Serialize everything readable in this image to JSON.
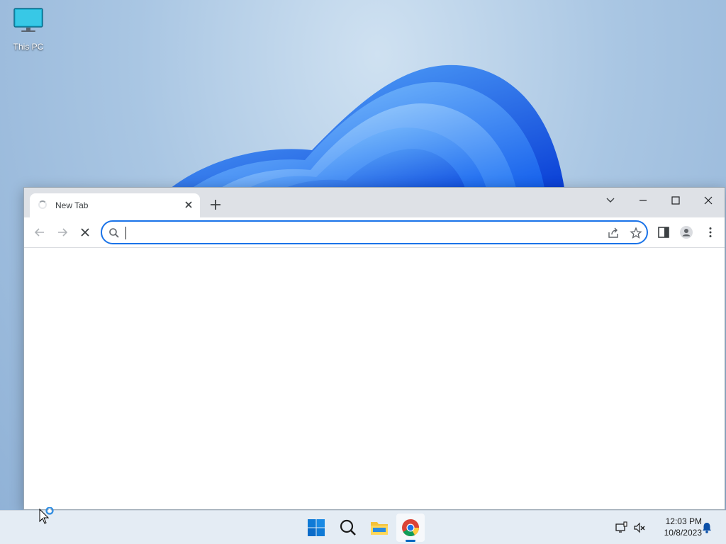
{
  "desktop": {
    "icons": [
      {
        "label": "This PC",
        "icon": "monitor-icon"
      }
    ]
  },
  "browser": {
    "tabs": [
      {
        "title": "New Tab",
        "state": "loading",
        "active": true
      }
    ],
    "window_controls": [
      "tab-search-icon",
      "minimize-icon",
      "maximize-icon",
      "close-icon"
    ],
    "toolbar": {
      "back_icon": "arrow-left-icon",
      "forward_icon": "arrow-right-icon",
      "stop_icon": "stop-x-icon",
      "right_icons": [
        "side-panel-icon",
        "profile-icon",
        "kebab-menu-icon"
      ]
    },
    "omnibox": {
      "value": "",
      "placeholder": "",
      "left_icon": "search-icon",
      "right_icons": [
        "share-icon",
        "star-icon"
      ]
    }
  },
  "taskbar": {
    "apps": [
      {
        "name": "start",
        "icon": "windows-logo-icon"
      },
      {
        "name": "search",
        "icon": "search-icon"
      },
      {
        "name": "file-explorer",
        "icon": "folder-icon"
      },
      {
        "name": "chrome",
        "icon": "chrome-icon",
        "active": true
      }
    ],
    "tray_icons": [
      "network-icon",
      "volume-muted-icon",
      "notification-bell-icon"
    ],
    "clock": {
      "time": "12:03 PM",
      "date": "10/8/2023"
    }
  },
  "colors": {
    "accent": "#1a73e8",
    "chrome_frame": "#dee1e6",
    "taskbar": "#e4ecf4",
    "taskbar_active": "#0067c0"
  }
}
